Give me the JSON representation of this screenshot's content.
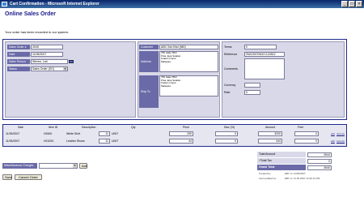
{
  "window": {
    "title": "Cart Confirmation - Microsoft Internet Explorer"
  },
  "page": {
    "title": "Online Sales Order",
    "message": "Your order has been recorded in our system."
  },
  "order": {
    "sales_order_label": "Sales Order #",
    "sales_order_value": "3045",
    "date_label": "Date",
    "date_value": "11/05/2007",
    "sales_person_label": "Sales Person",
    "sales_person_value": "Steven, Lah",
    "status_label": "Status",
    "status_value": "Sales Order (SO)",
    "customer_label": "Customer",
    "customer_value": "ABC Sdn Bhd (580)",
    "address_label": "Address",
    "address_lines": [
      "756 Jalan 55/2",
      "Puta Jaya Selatan",
      "Kuala Lumpur",
      "Malaysia"
    ],
    "ship_to_label": "Ship To",
    "ship_to_lines": [
      "756 Jalan 55/2",
      "Puta Jaya Selatan",
      "Kuala Lumpur",
      "Malaysia"
    ],
    "terms_label": "Terms",
    "terms_value": "0",
    "reference_label": "Reference",
    "reference_value": "SW12007061H-124512",
    "comments_label": "Comments",
    "comments_value": "",
    "currency_label": "Currency",
    "currency_value": "",
    "rate_label": "Rate",
    "rate_value": "0"
  },
  "items_table": {
    "headers": [
      "Sale",
      "Item ID",
      "Description",
      "Qty",
      "Price",
      "Disc (%)",
      "Amount",
      "Free"
    ],
    "rows": [
      {
        "sale": "11/05/2007",
        "item_id": "H2600",
        "description": "White Shirt",
        "qty": "11",
        "unit": "UNIT",
        "price": "290",
        "disc": "0",
        "amount": "3200",
        "free": "0",
        "edit": "edit",
        "remove": "remove"
      },
      {
        "sale": "11/05/2007",
        "item_id": "H21000",
        "description": "Leather Shoes",
        "qty": "11",
        "unit": "UNIT",
        "price": "44",
        "disc": "0",
        "amount": "444",
        "free": "0",
        "edit": "edit",
        "remove": "remove"
      }
    ]
  },
  "summary": {
    "total_amount_label": "Total Amount",
    "total_amount_value": "2644",
    "tax_label": "+Total Tax",
    "tax_value": "0",
    "grand_total_label": "Grand Total",
    "grand_total_value": "2640",
    "created_by_label": "Created by",
    "created_by_value": "EBT on 11/05/2007",
    "updated_by_label": "Last updated by",
    "updated_by_value": "EBT on 11 05 2007 12:30:12 PM"
  },
  "misc_charges": {
    "label": "Miscellaneous Charges",
    "select_value": "",
    "add_label": "Add"
  },
  "actions": {
    "save_label": "Save",
    "cancel_label": "Cancel Order"
  }
}
